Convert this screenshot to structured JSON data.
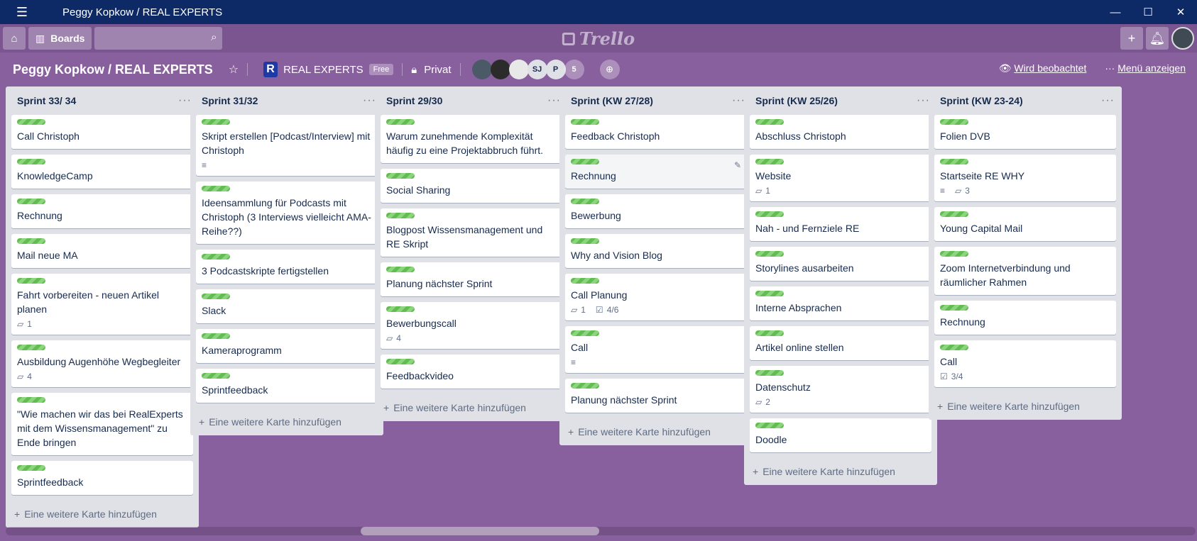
{
  "window": {
    "title": "Peggy Kopkow / REAL EXPERTS",
    "minimize": "—",
    "maximize": "☐",
    "close": "✕"
  },
  "header": {
    "boards_label": "Boards",
    "logo_text": "Trello"
  },
  "board": {
    "title": "Peggy Kopkow / REAL EXPERTS",
    "team_name": "REAL EXPERTS",
    "team_logo": "R",
    "team_badge": "Free",
    "visibility": "Privat",
    "members": [
      "",
      "",
      "",
      "SJ",
      "P"
    ],
    "member_count": "5",
    "watch_label": "Wird beobachtet",
    "menu_label": "Menü anzeigen"
  },
  "add_card_label": "Eine weitere Karte hinzufügen",
  "lists": [
    {
      "title": "Sprint 33/ 34",
      "cards": [
        {
          "text": "Call Christoph"
        },
        {
          "text": "KnowledgeCamp"
        },
        {
          "text": "Rechnung"
        },
        {
          "text": "Mail neue MA"
        },
        {
          "text": "Fahrt vorbereiten - neuen Artikel planen",
          "comments": "1"
        },
        {
          "text": "Ausbildung Augenhöhe Wegbegleiter",
          "comments": "4"
        },
        {
          "text": "\"Wie machen wir das bei RealExperts mit dem Wissensmanagement\" zu Ende bringen"
        },
        {
          "text": "Sprintfeedback"
        }
      ]
    },
    {
      "title": "Sprint 31/32",
      "cards": [
        {
          "text": "Skript erstellen [Podcast/Interview] mit Christoph",
          "description": true
        },
        {
          "text": "Ideensammlung für Podcasts mit Christoph (3 Interviews vielleicht AMA-Reihe??)"
        },
        {
          "text": "3 Podcastskripte fertigstellen"
        },
        {
          "text": "Slack"
        },
        {
          "text": "Kameraprogramm"
        },
        {
          "text": "Sprintfeedback"
        }
      ]
    },
    {
      "title": "Sprint 29/30",
      "cards": [
        {
          "text": "Warum zunehmende Komplexität häufig zu eine Projektabbruch führt."
        },
        {
          "text": "Social Sharing"
        },
        {
          "text": "Blogpost Wissensmanagement und RE Skript"
        },
        {
          "text": "Planung nächster Sprint"
        },
        {
          "text": "Bewerbungscall",
          "comments": "4"
        },
        {
          "text": "Feedbackvideo"
        }
      ]
    },
    {
      "title": "Sprint (KW 27/28)",
      "cards": [
        {
          "text": "Feedback Christoph"
        },
        {
          "text": "Rechnung",
          "hover": true
        },
        {
          "text": "Bewerbung"
        },
        {
          "text": "Why and Vision Blog"
        },
        {
          "text": "Call Planung",
          "comments": "1",
          "checklist": "4/6"
        },
        {
          "text": "Call",
          "description": true
        },
        {
          "text": "Planung nächster Sprint"
        }
      ]
    },
    {
      "title": "Sprint (KW 25/26)",
      "cards": [
        {
          "text": "Abschluss Christoph"
        },
        {
          "text": "Website",
          "comments": "1"
        },
        {
          "text": "Nah - und Fernziele RE"
        },
        {
          "text": "Storylines ausarbeiten"
        },
        {
          "text": "Interne Absprachen"
        },
        {
          "text": "Artikel online stellen"
        },
        {
          "text": "Datenschutz",
          "comments": "2"
        },
        {
          "text": "Doodle"
        }
      ]
    },
    {
      "title": "Sprint (KW 23-24)",
      "cards": [
        {
          "text": "Folien DVB"
        },
        {
          "text": "Startseite RE WHY",
          "description": true,
          "comments": "3"
        },
        {
          "text": "Young Capital Mail"
        },
        {
          "text": "Zoom Internetverbindung und räumlicher Rahmen"
        },
        {
          "text": "Rechnung"
        },
        {
          "text": "Call",
          "checklist": "3/4"
        }
      ]
    }
  ]
}
